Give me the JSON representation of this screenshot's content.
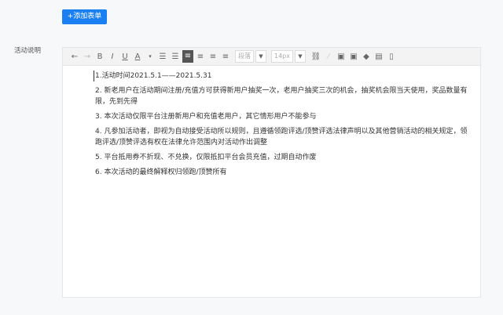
{
  "add_form_button": "+添加表单",
  "field_label": "活动说明",
  "toolbar": {
    "icons": [
      "undo",
      "redo",
      "bold",
      "italic",
      "underline",
      "font-color",
      "caret",
      "ordered-list",
      "unordered-list",
      "align-left",
      "align-center",
      "align-right",
      "align-justify"
    ],
    "paragraph_select": "段落",
    "fontsize_select": "14px",
    "tail_icons": [
      "link",
      "unlink",
      "image",
      "video",
      "eraser",
      "paste",
      "file"
    ]
  },
  "content": [
    "1.活动时间2021.5.1——2021.5.31",
    "2. 新老用户在活动期间注册/充值方可获得新用户抽奖一次，老用户抽奖三次的机会，抽奖机会限当天使用，奖品数量有限，先到先得",
    "3. 本次活动仅限平台注册新用户和充值老用户，其它情形用户不能参与",
    "4. 凡参加活动者，即视为自动接受活动所以规则，且遵循领跑评选/顶赞评选法律声明以及其他营销活动的相关规定，领跑评选/顶赞评选有权在法律允许范围内对活动作出调整",
    "5. 平台抵用券不折现、不兑换，仅限抵扣平台会员充值，过期自动作废",
    "6. 本次活动的最终解释权归领跑/顶赞所有"
  ]
}
